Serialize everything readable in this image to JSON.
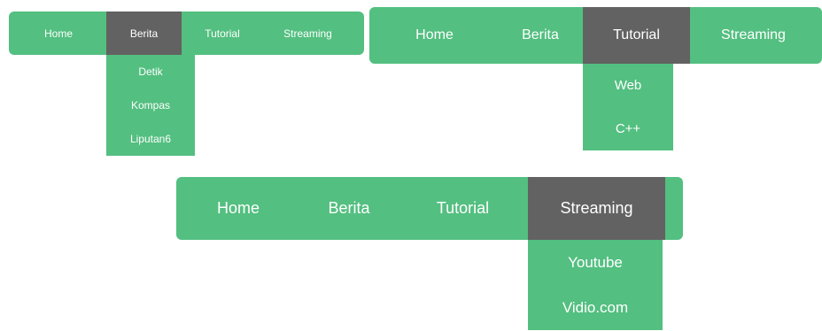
{
  "colors": {
    "nav_background": "#53bf80",
    "active_background": "#626262",
    "text": "#ffffff"
  },
  "menu1": {
    "items": [
      "Home",
      "Berita",
      "Tutorial",
      "Streaming"
    ],
    "active": "Berita",
    "dropdown": [
      "Detik",
      "Kompas",
      "Liputan6"
    ]
  },
  "menu2": {
    "items": [
      "Home",
      "Berita",
      "Tutorial",
      "Streaming"
    ],
    "active": "Tutorial",
    "dropdown": [
      "Web",
      "C++"
    ]
  },
  "menu3": {
    "items": [
      "Home",
      "Berita",
      "Tutorial",
      "Streaming"
    ],
    "active": "Streaming",
    "dropdown": [
      "Youtube",
      "Vidio.com"
    ]
  }
}
